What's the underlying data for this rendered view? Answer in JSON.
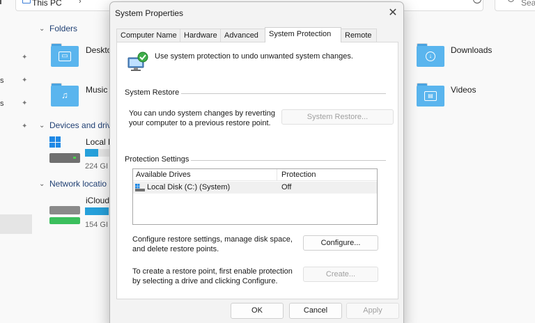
{
  "explorer": {
    "address_text": "This PC",
    "search_placeholder": "Sea",
    "sidebar_fragments": [
      "s",
      "s"
    ],
    "sections": {
      "folders": "Folders",
      "devices": "Devices and driv",
      "network": "Network locatio"
    },
    "folders": [
      {
        "label": "Deskto",
        "icon": "desktop-folder-icon"
      },
      {
        "label": "Music",
        "icon": "music-folder-icon"
      },
      {
        "label": "Downloads",
        "icon": "downloads-folder-icon"
      },
      {
        "label": "Videos",
        "icon": "videos-folder-icon"
      }
    ],
    "drives": [
      {
        "label": "Local D",
        "free": "224 GI",
        "used_fraction": 0.45
      },
      {
        "label": "iCloud",
        "free": "154 GI",
        "used_fraction": 0.8
      }
    ]
  },
  "dialog": {
    "title": "System Properties",
    "close_glyph": "✕",
    "tabs": [
      {
        "label": "Computer Name",
        "active": false
      },
      {
        "label": "Hardware",
        "active": false
      },
      {
        "label": "Advanced",
        "active": false
      },
      {
        "label": "System Protection",
        "active": true
      },
      {
        "label": "Remote",
        "active": false
      }
    ],
    "intro": "Use system protection to undo unwanted system changes.",
    "system_restore": {
      "heading": "System Restore",
      "desc_line1": "You can undo system changes by reverting",
      "desc_line2": "your computer to a previous restore point.",
      "button": "System Restore..."
    },
    "protection": {
      "heading": "Protection Settings",
      "columns": [
        "Available Drives",
        "Protection"
      ],
      "rows": [
        {
          "drive": "Local Disk (C:) (System)",
          "protection": "Off"
        }
      ],
      "configure_line1": "Configure restore settings, manage disk space,",
      "configure_line2": "and delete restore points.",
      "configure_button": "Configure...",
      "create_line1": "To create a restore point, first enable protection",
      "create_line2": "by selecting a drive and clicking Configure.",
      "create_button": "Create..."
    },
    "footer": {
      "ok": "OK",
      "cancel": "Cancel",
      "apply": "Apply"
    }
  },
  "colors": {
    "accent": "#26a0da",
    "folder": "#5ab5ee",
    "dialog_bg": "#f3f3f3"
  }
}
